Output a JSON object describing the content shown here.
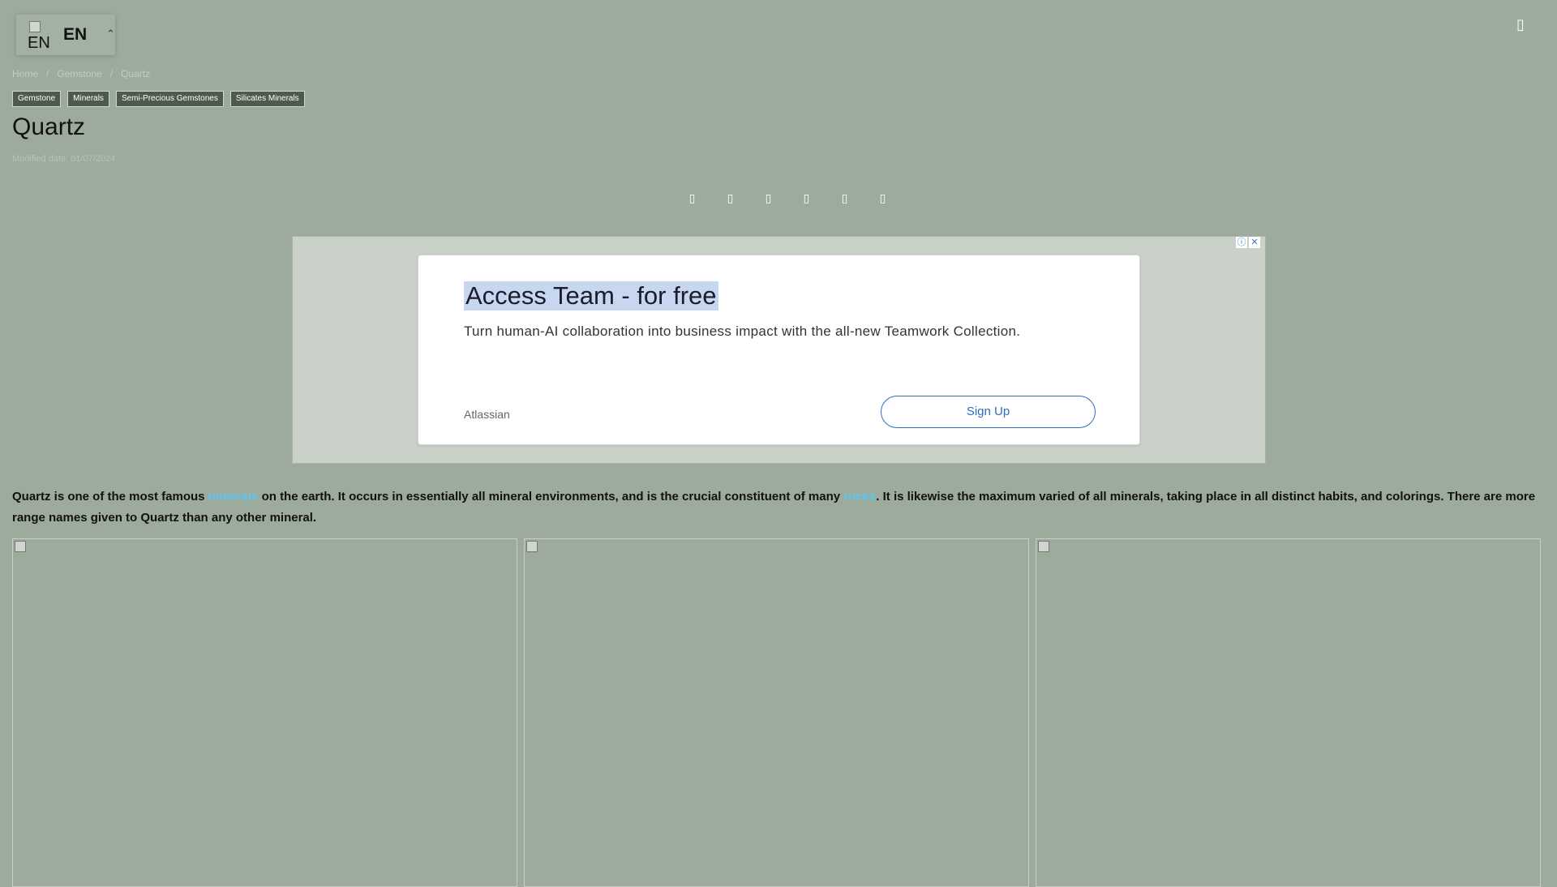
{
  "language": {
    "flag_alt": "EN",
    "code": "EN",
    "icon": "chevron-up-icon"
  },
  "header": {
    "menu_icon": "menu-icon"
  },
  "breadcrumb": [
    "Home",
    "Gemstone",
    "Quartz"
  ],
  "tags": [
    "Gemstone",
    "Minerals",
    "Semi-Precious Gemstones",
    "Silicates Minerals"
  ],
  "article": {
    "title": "Quartz",
    "modified": "Modified date: 01/07/2024",
    "intro": {
      "part1": "Quartz is one of the most famous ",
      "link1": "minerals",
      "part2": " on the earth. It occurs in essentially all mineral environments, and is the crucial constituent of many ",
      "link2": "rocks",
      "part3": ". It is likewise the maximum varied of all minerals, taking place in all distinct habits, and colorings. There are more range names given to Quartz than any other mineral."
    }
  },
  "share_icons": [
    "facebook-icon",
    "twitter-icon",
    "pinterest-icon",
    "whatsapp-icon",
    "linkedin-icon",
    "email-icon"
  ],
  "ad": {
    "headline": "Access Team - for free",
    "body": "Turn human-AI collaboration into business impact with the all-new Teamwork Collection.",
    "advertiser": "Atlassian",
    "cta": "Sign Up",
    "info_icon": "info-icon",
    "close_icon": "close-icon"
  },
  "colors": {
    "background": "#9dab9d",
    "link": "#5ec5ee",
    "cta": "#2c6ec3"
  }
}
